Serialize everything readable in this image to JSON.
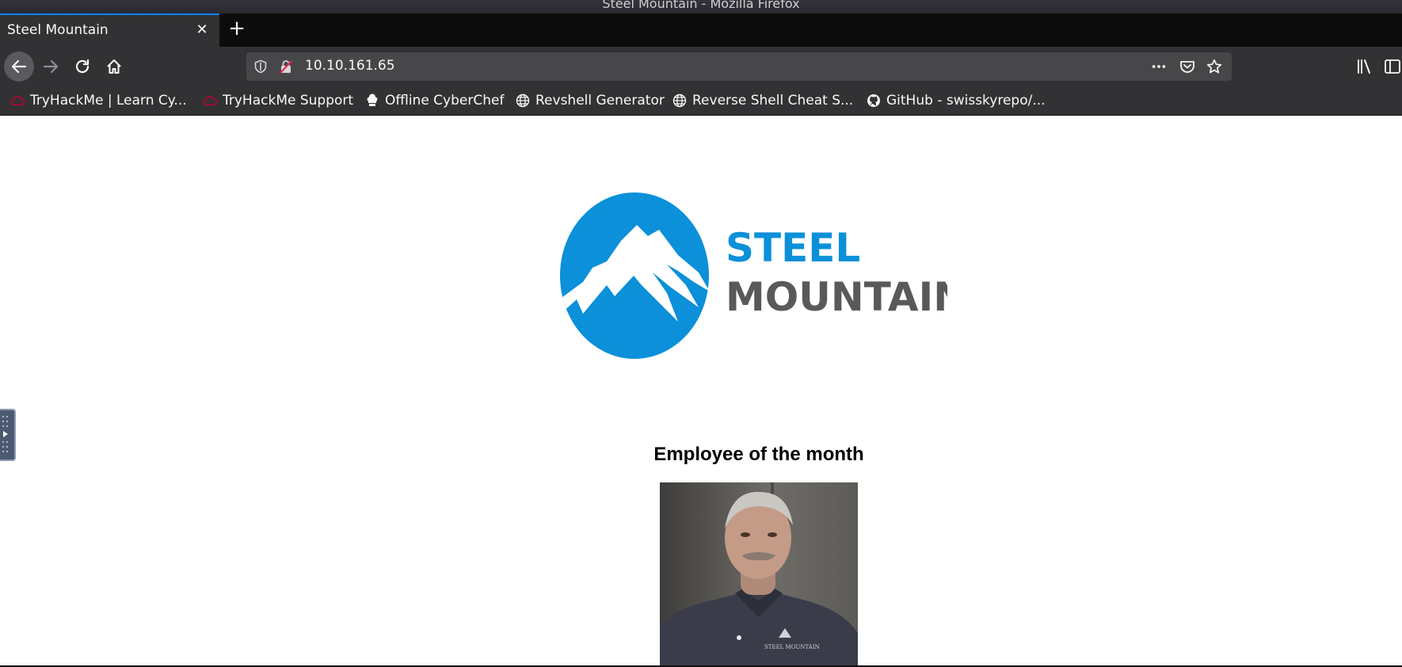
{
  "window": {
    "title": "Steel Mountain - Mozilla Firefox"
  },
  "tabs": [
    {
      "label": "Steel Mountain",
      "active": true
    }
  ],
  "tab_controls": {
    "close_glyph": "✕",
    "new_tab_glyph": "+"
  },
  "navbar": {
    "url": "10.10.161.65",
    "icons": [
      "back-icon",
      "forward-icon",
      "reload-icon",
      "home-icon",
      "shield-icon",
      "insecure-lock-icon",
      "page-actions-icon",
      "pocket-icon",
      "bookmark-star-icon",
      "library-icon",
      "sidebar-icon"
    ]
  },
  "bookmarks": [
    {
      "label": "TryHackMe | Learn Cy...",
      "icon": "tryhackme-icon"
    },
    {
      "label": "TryHackMe Support",
      "icon": "tryhackme-icon"
    },
    {
      "label": "Offline CyberChef",
      "icon": "chef-icon"
    },
    {
      "label": "Revshell Generator",
      "icon": "globe-icon"
    },
    {
      "label": "Reverse Shell Cheat S...",
      "icon": "globe-icon"
    },
    {
      "label": "GitHub - swisskyrepo/...",
      "icon": "github-icon"
    }
  ],
  "page": {
    "logo_line1": "STEEL",
    "logo_line2": "MOUNTAIN",
    "heading": "Employee of the month",
    "photo_caption": "STEEL MOUNTAIN"
  },
  "colors": {
    "brand_blue": "#0b90d9",
    "brand_gray": "#58595b",
    "accent_tab": "#0a84ff",
    "toolbar_bg": "#323234"
  }
}
